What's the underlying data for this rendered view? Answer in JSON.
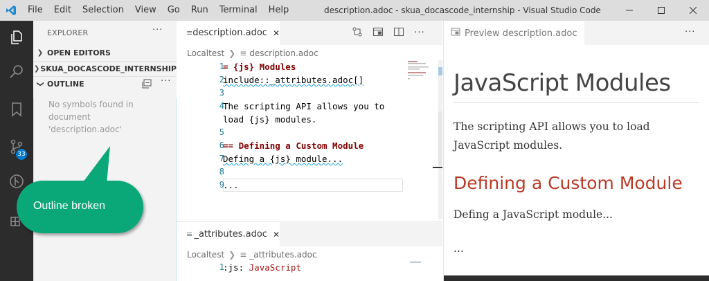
{
  "titlebar": {
    "menu": [
      "File",
      "Edit",
      "Selection",
      "View",
      "Go",
      "Run",
      "Terminal",
      "Help"
    ],
    "title": "description.adoc - skua_docascode_internship - Visual Studio Code"
  },
  "activitybar": {
    "items": [
      "explorer-icon",
      "search-icon",
      "bookmark-icon",
      "source-control-icon",
      "git-graph-icon",
      "extensions-icon"
    ],
    "source_control_badge": "33"
  },
  "sidebar": {
    "title": "EXPLORER",
    "more": "···",
    "sections": {
      "open_editors": "OPEN EDITORS",
      "workspace": "SKUA_DOCASCODE_INTERNSHIP",
      "outline": "OUTLINE"
    },
    "outline_message": "No symbols found in document 'description.adoc'"
  },
  "callout": {
    "text": "Outline broken",
    "color": "#0aa878"
  },
  "editor1": {
    "tab_label": "description.adoc",
    "breadcrumb": [
      "Localtest",
      "description.adoc"
    ],
    "lines": [
      {
        "n": "1",
        "text": "= {js} Modules"
      },
      {
        "n": "2",
        "text": "include::_attributes.adoc[]"
      },
      {
        "n": "3",
        "text": ""
      },
      {
        "n": "4",
        "text": "The scripting API allows you to"
      },
      {
        "n": "",
        "text": "load {js} modules."
      },
      {
        "n": "5",
        "text": ""
      },
      {
        "n": "6",
        "text": "== Defining a Custom Module"
      },
      {
        "n": "7",
        "text": "Defing a {js} module..."
      },
      {
        "n": "8",
        "text": ""
      },
      {
        "n": "9",
        "text": "..."
      }
    ]
  },
  "editor2": {
    "tab_label": "_attributes.adoc",
    "breadcrumb": [
      "Localtest",
      "_attributes.adoc"
    ],
    "lines": [
      {
        "n": "1",
        "key": ":js:",
        "value": "JavaScript"
      }
    ]
  },
  "preview": {
    "tab_label": "Preview description.adoc",
    "more": "···",
    "title": "JavaScript Modules",
    "para1_line1": "The scripting API allows you to load",
    "para1_line2": "JavaScript modules.",
    "h2": "Defining a Custom Module",
    "para2": "Defing a JavaScript module...",
    "para3": "..."
  },
  "colors": {
    "accent": "#007acc",
    "heading_red": "#ba3925",
    "line_number": "#237893"
  }
}
